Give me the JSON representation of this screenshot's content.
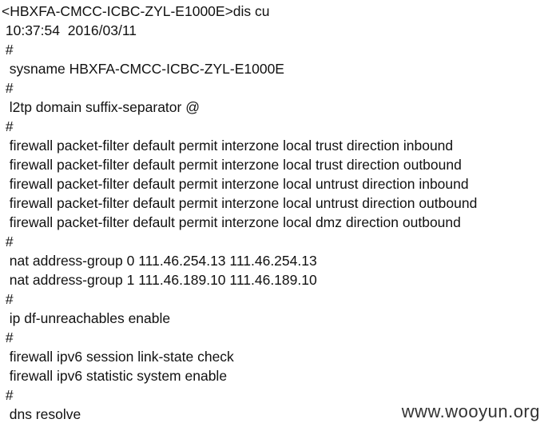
{
  "terminal": {
    "lines": [
      "<HBXFA-CMCC-ICBC-ZYL-E1000E>dis cu",
      " 10:37:54  2016/03/11",
      " #",
      "  sysname HBXFA-CMCC-ICBC-ZYL-E1000E",
      " #",
      "  l2tp domain suffix-separator @",
      " #",
      "  firewall packet-filter default permit interzone local trust direction inbound",
      "  firewall packet-filter default permit interzone local trust direction outbound",
      "  firewall packet-filter default permit interzone local untrust direction inbound",
      "  firewall packet-filter default permit interzone local untrust direction outbound",
      "  firewall packet-filter default permit interzone local dmz direction outbound",
      " #",
      "  nat address-group 0 111.46.254.13 111.46.254.13",
      "  nat address-group 1 111.46.189.10 111.46.189.10",
      " #",
      "  ip df-unreachables enable",
      " #",
      "  firewall ipv6 session link-state check",
      "  firewall ipv6 statistic system enable",
      " #",
      "  dns resolve"
    ]
  },
  "watermark": "www.wooyun.org"
}
